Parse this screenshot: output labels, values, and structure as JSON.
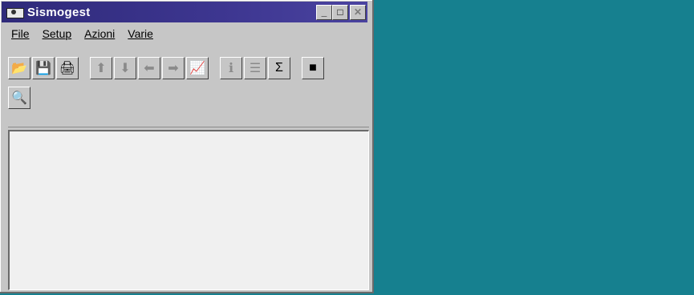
{
  "window": {
    "title": "Sismogest",
    "title_color": "#3d3690",
    "controls": {
      "minimize": "_",
      "maximize": "□",
      "close": "✕"
    }
  },
  "menu": {
    "items": [
      {
        "label": "File"
      },
      {
        "label": "Setup"
      },
      {
        "label": "Azioni"
      },
      {
        "label": "Varie"
      }
    ]
  },
  "toolbar": {
    "buttons": [
      {
        "icon": "open-folder-icon",
        "glyph": "📂"
      },
      {
        "icon": "save-disk-icon",
        "glyph": "💾"
      },
      {
        "icon": "print-icon",
        "glyph": "🖨"
      },
      {
        "icon": "arrow-up-icon",
        "glyph": "⬆"
      },
      {
        "icon": "arrow-down-icon",
        "glyph": "⬇"
      },
      {
        "icon": "arrow-left-icon",
        "glyph": "⬅"
      },
      {
        "icon": "arrow-right-icon",
        "glyph": "➡"
      },
      {
        "icon": "chart-icon",
        "glyph": "📈"
      },
      {
        "icon": "info-icon",
        "glyph": "ℹ"
      },
      {
        "icon": "list-icon",
        "glyph": "☰"
      },
      {
        "icon": "sum-icon",
        "glyph": "Σ"
      },
      {
        "icon": "stop-icon",
        "glyph": "■"
      }
    ],
    "second_row": [
      {
        "icon": "view-icon",
        "glyph": "🔍"
      }
    ]
  },
  "colors": {
    "desktop": "#16808f",
    "window_bg": "#c6c6c6",
    "content_bg": "#f0f0f0"
  }
}
